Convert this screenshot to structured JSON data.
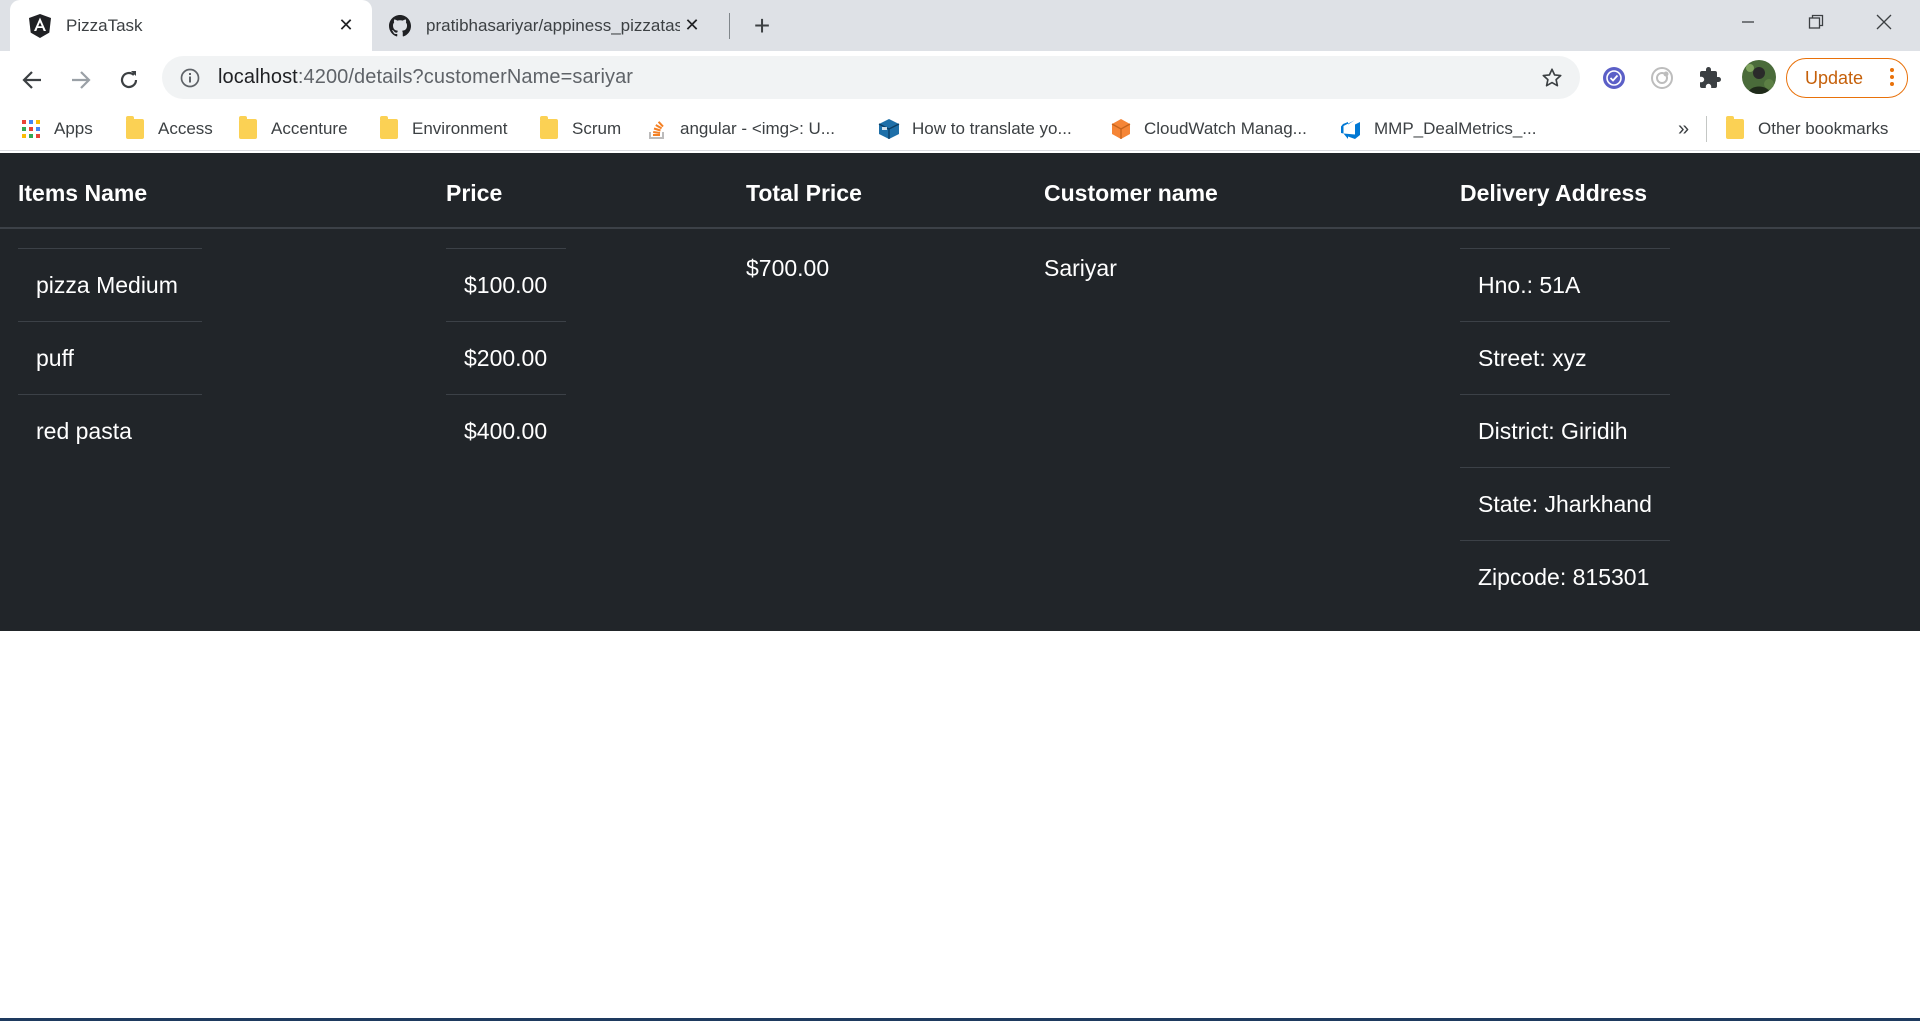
{
  "browser": {
    "tabs": [
      {
        "title": "PizzaTask",
        "icon": "angular-icon",
        "active": true
      },
      {
        "title": "pratibhasariyar/appiness_pizzatask",
        "icon": "github-icon",
        "active": false
      }
    ],
    "url_host": "localhost",
    "url_rest": ":4200/details?customerName=sariyar",
    "update_label": "Update",
    "bookmarks": [
      {
        "label": "Apps",
        "icon": "apps-grid-icon"
      },
      {
        "label": "Access",
        "icon": "folder-icon"
      },
      {
        "label": "Accenture",
        "icon": "folder-icon"
      },
      {
        "label": "Environment",
        "icon": "folder-icon"
      },
      {
        "label": "Scrum",
        "icon": "folder-icon"
      },
      {
        "label": "angular - <img>: U...",
        "icon": "stackoverflow-icon"
      },
      {
        "label": "How to translate yo...",
        "icon": "box-icon"
      },
      {
        "label": "CloudWatch Manag...",
        "icon": "aws-icon"
      },
      {
        "label": "MMP_DealMetrics_...",
        "icon": "azure-devops-icon"
      }
    ],
    "overflow_label": "»",
    "other_bookmarks": "Other bookmarks"
  },
  "table": {
    "headers": {
      "items": "Items Name",
      "price": "Price",
      "total": "Total Price",
      "customer": "Customer name",
      "address": "Delivery Address"
    },
    "items": [
      "pizza Medium",
      "puff",
      "red pasta"
    ],
    "prices": [
      "$100.00",
      "$200.00",
      "$400.00"
    ],
    "total_price": "$700.00",
    "customer_name": "Sariyar",
    "address": [
      "Hno.: 51A",
      "Street: xyz",
      "District: Giridih",
      "State: Jharkhand",
      "Zipcode: 815301"
    ]
  },
  "colors": {
    "page_bg": "#212529",
    "accent_update": "#e8710a"
  }
}
